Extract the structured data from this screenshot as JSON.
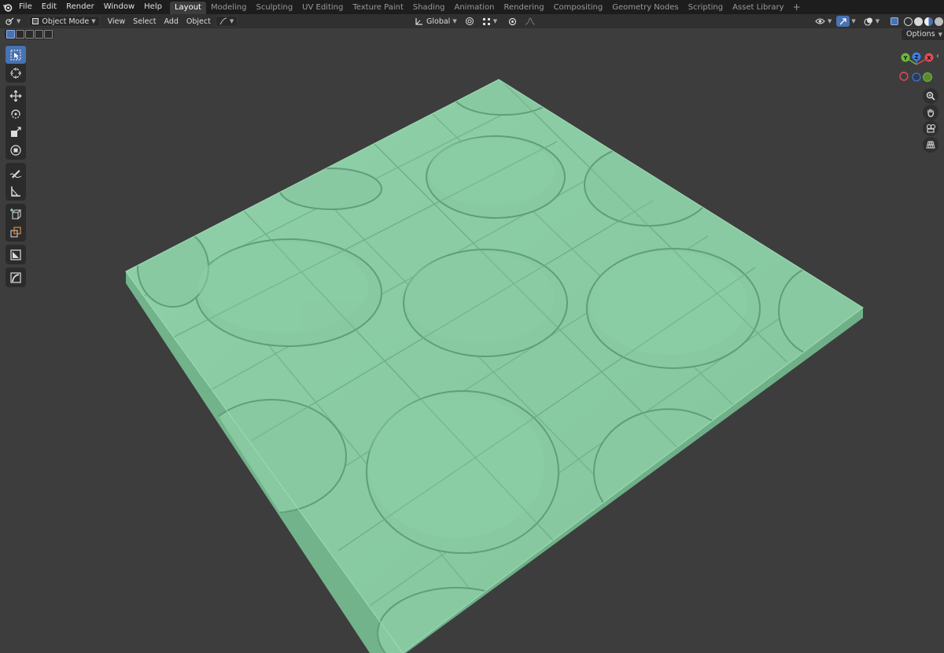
{
  "menu": [
    "File",
    "Edit",
    "Render",
    "Window",
    "Help"
  ],
  "workspaces": [
    {
      "label": "Layout",
      "active": true
    },
    {
      "label": "Modeling"
    },
    {
      "label": "Sculpting"
    },
    {
      "label": "UV Editing"
    },
    {
      "label": "Texture Paint"
    },
    {
      "label": "Shading"
    },
    {
      "label": "Animation"
    },
    {
      "label": "Rendering"
    },
    {
      "label": "Compositing"
    },
    {
      "label": "Geometry Nodes"
    },
    {
      "label": "Scripting"
    },
    {
      "label": "Asset Library"
    }
  ],
  "header": {
    "mode": "Object Mode",
    "view": "View",
    "select": "Select",
    "add": "Add",
    "object": "Object",
    "orientation": "Global"
  },
  "options_label": "Options",
  "gizmo": {
    "y": "Y",
    "z": "Z",
    "x": "X"
  },
  "colors": {
    "accent": "#4772b3",
    "tile": "#86c9a0",
    "background": "#3d3d3d",
    "axis_x": "#e34a57",
    "axis_y": "#6fb93a",
    "axis_z": "#3f7ee0"
  }
}
